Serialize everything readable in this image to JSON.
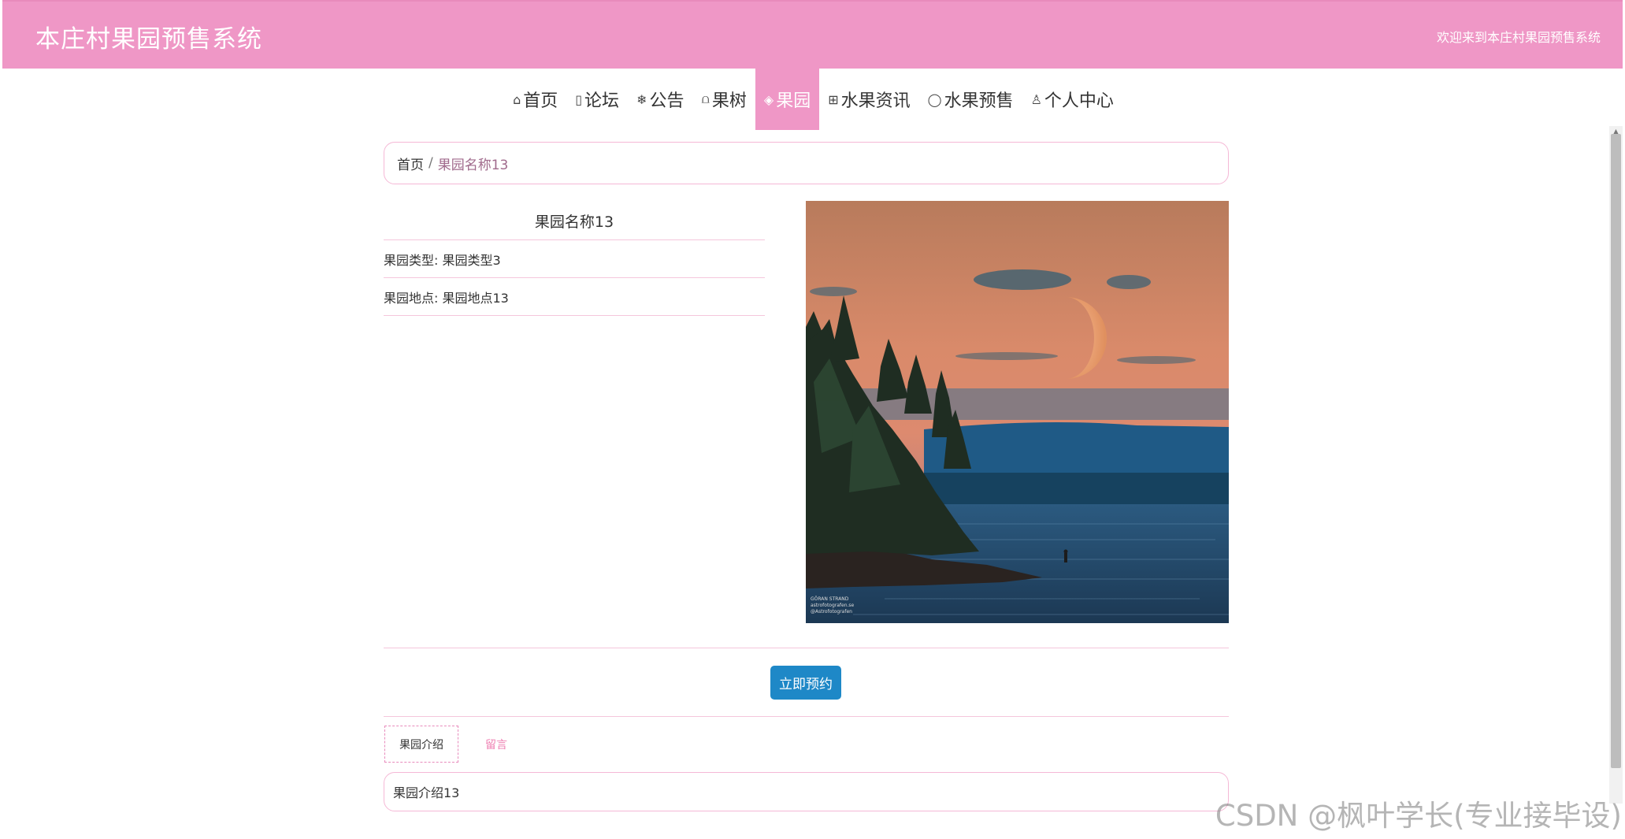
{
  "header": {
    "title": "本庄村果园预售系统",
    "welcome": "欢迎来到本庄村果园预售系统"
  },
  "nav": {
    "items": [
      {
        "icon": "home-icon",
        "glyph": "⌂",
        "label": "首页"
      },
      {
        "icon": "document-icon",
        "glyph": "▯",
        "label": "论坛"
      },
      {
        "icon": "snowflake-icon",
        "glyph": "❄",
        "label": "公告"
      },
      {
        "icon": "book-icon",
        "glyph": "⩍",
        "label": "果树"
      },
      {
        "icon": "layers-icon",
        "glyph": "◈",
        "label": "果园"
      },
      {
        "icon": "gift-icon",
        "glyph": "⊞",
        "label": "水果资讯"
      },
      {
        "icon": "clock-icon",
        "glyph": "◯",
        "label": "水果预售"
      },
      {
        "icon": "user-icon",
        "glyph": "♙",
        "label": "个人中心"
      }
    ],
    "active": "果园"
  },
  "breadcrumb": {
    "home": "首页",
    "separator": "/",
    "current": "果园名称13"
  },
  "detail": {
    "name": "果园名称13",
    "type_label": "果园类型: 果园类型3",
    "location_label": "果园地点: 果园地点13"
  },
  "photo": {
    "credit_line1": "GÖRAN STRAND",
    "credit_line2": "astrofotografen.se",
    "credit_line3": "@Astrofotografen"
  },
  "actions": {
    "reserve": "立即预约"
  },
  "tabs": {
    "intro": "果园介绍",
    "comment": "留言"
  },
  "content": {
    "intro_text": "果园介绍13"
  },
  "watermark": "CSDN @枫叶学长(专业接毕设)",
  "colors": {
    "brand_pink": "#ef97c6",
    "button_blue": "#1e88c7",
    "comment_tab": "#ef7fb2"
  }
}
